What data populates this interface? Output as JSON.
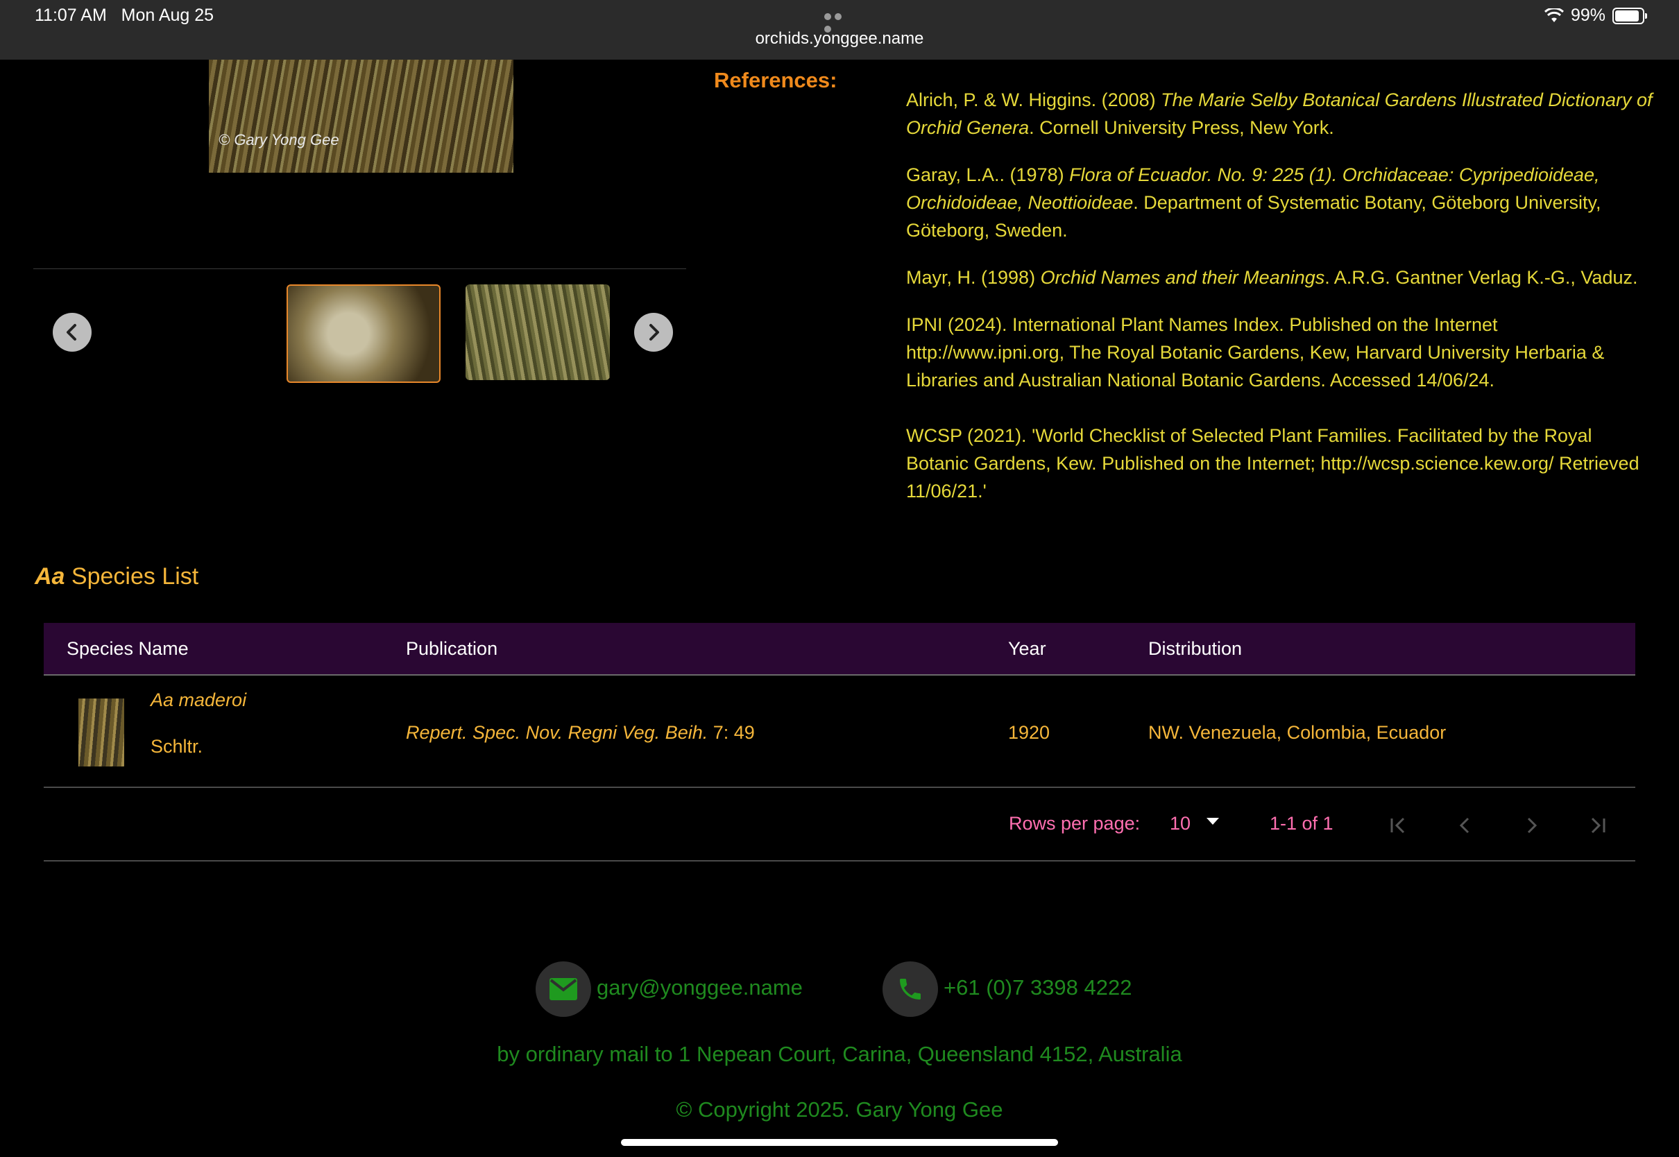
{
  "status_bar": {
    "time": "11:07 AM",
    "date": "Mon Aug 25",
    "url": "orchids.yonggee.name",
    "battery": "99%"
  },
  "gallery": {
    "photo_credit": "© Gary Yong Gee",
    "thumbnails": [
      "thumbnail-1",
      "thumbnail-2"
    ]
  },
  "references": {
    "heading": "References:",
    "items": [
      {
        "pre": "Alrich, P. & W. Higgins. (2008) ",
        "title": "The Marie Selby Botanical Gardens Illustrated Dictionary of Orchid Genera",
        "post": ". Cornell University Press, New York."
      },
      {
        "pre": "Garay, L.A.. (1978) ",
        "title": "Flora of Ecuador. No. 9: 225 (1). Orchidaceae: Cypripedioideae, Orchidoideae, Neottioideae",
        "post": ". Department of Systematic Botany, Göteborg University, Göteborg, Sweden."
      },
      {
        "pre": "Mayr, H. (1998) ",
        "title": "Orchid Names and their Meanings",
        "post": ". A.R.G. Gantner Verlag K.-G., Vaduz."
      },
      {
        "pre": "IPNI (2024). International Plant Names Index. Published on the Internet http://www.ipni.org, The Royal Botanic Gardens, Kew, Harvard University Herbaria & Libraries and Australian National Botanic Gardens. Accessed 14/06/24.",
        "title": "",
        "post": ""
      },
      {
        "pre": "WCSP (2021). 'World Checklist of Selected Plant Families. Facilitated by the Royal Botanic Gardens, Kew. Published on the Internet; http://wcsp.science.kew.org/ Retrieved 11/06/21.'",
        "title": "",
        "post": ""
      }
    ]
  },
  "species": {
    "genus": "Aa",
    "title_suffix": " Species List",
    "columns": [
      "Species Name",
      "Publication",
      "Year",
      "Distribution"
    ],
    "rows": [
      {
        "name": "Aa maderoi",
        "author": "Schltr.",
        "publication_title": "Repert. Spec. Nov. Regni Veg. Beih.",
        "publication_ref": " 7: 49",
        "year": "1920",
        "distribution": "NW. Venezuela, Colombia, Ecuador"
      }
    ],
    "pager": {
      "rows_label": "Rows per page:",
      "rows_value": "10",
      "range": "1-1 of 1"
    }
  },
  "footer": {
    "email": "gary@yonggee.name",
    "phone": "+61 (0)7 3398 4222",
    "mail": "by ordinary mail to 1 Nepean Court, Carina, Queensland 4152, Australia",
    "copyright": "© Copyright 2025. Gary Yong Gee"
  }
}
